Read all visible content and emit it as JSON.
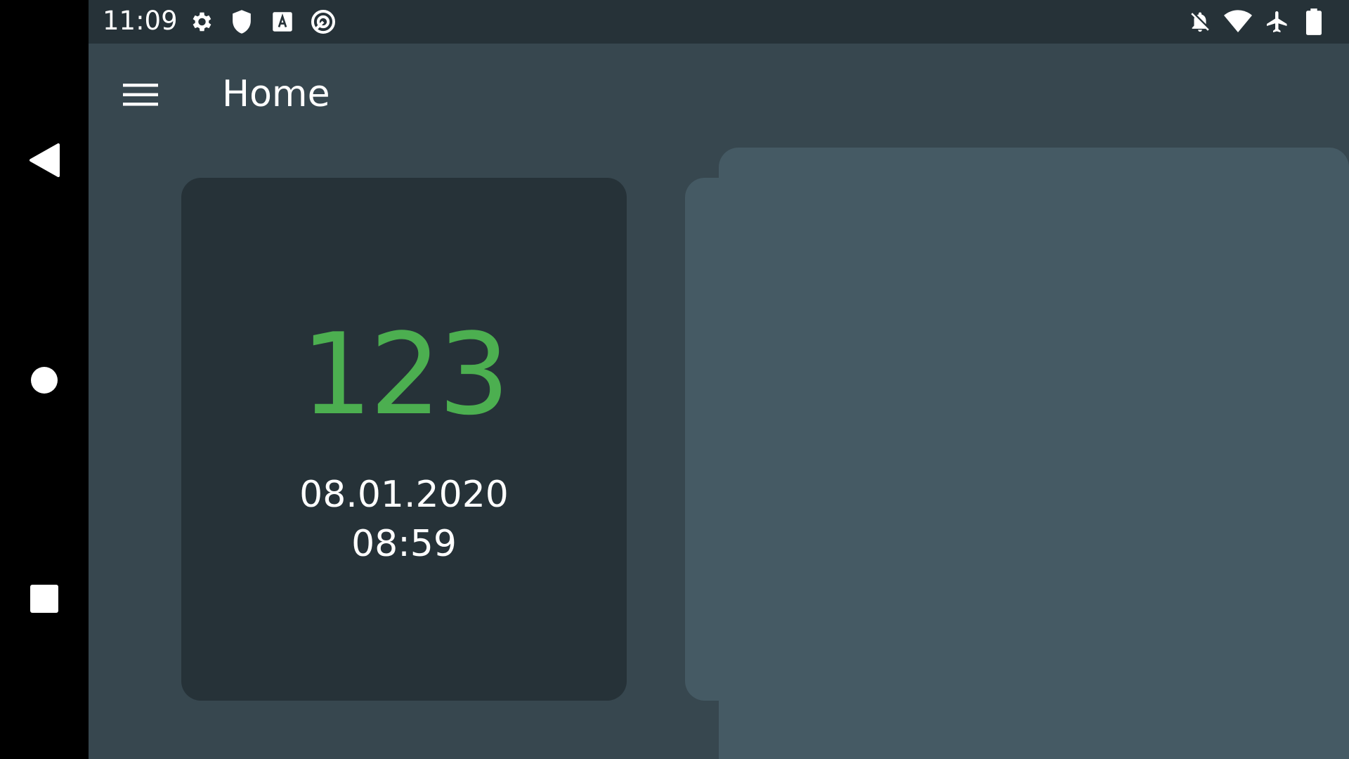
{
  "status_bar": {
    "time": "11:09",
    "left_icons": [
      "gear-icon",
      "shield-icon",
      "text-recognition-icon",
      "sync-circle-icon"
    ],
    "right_icons": [
      "notifications-off-icon",
      "wifi-icon",
      "airplane-mode-icon",
      "battery-icon"
    ]
  },
  "navigation": {
    "buttons": [
      "back-icon",
      "home-icon",
      "recents-icon"
    ]
  },
  "app_bar": {
    "menu_icon": "hamburger-menu-icon",
    "title": "Home"
  },
  "card": {
    "value": "123",
    "date": "08.01.2020",
    "time": "08:59"
  },
  "colors": {
    "background": "#37474f",
    "status_bar": "#263238",
    "card": "#263238",
    "panel": "#455a64",
    "accent_green": "#4caf50",
    "nav_bar": "#000000"
  }
}
